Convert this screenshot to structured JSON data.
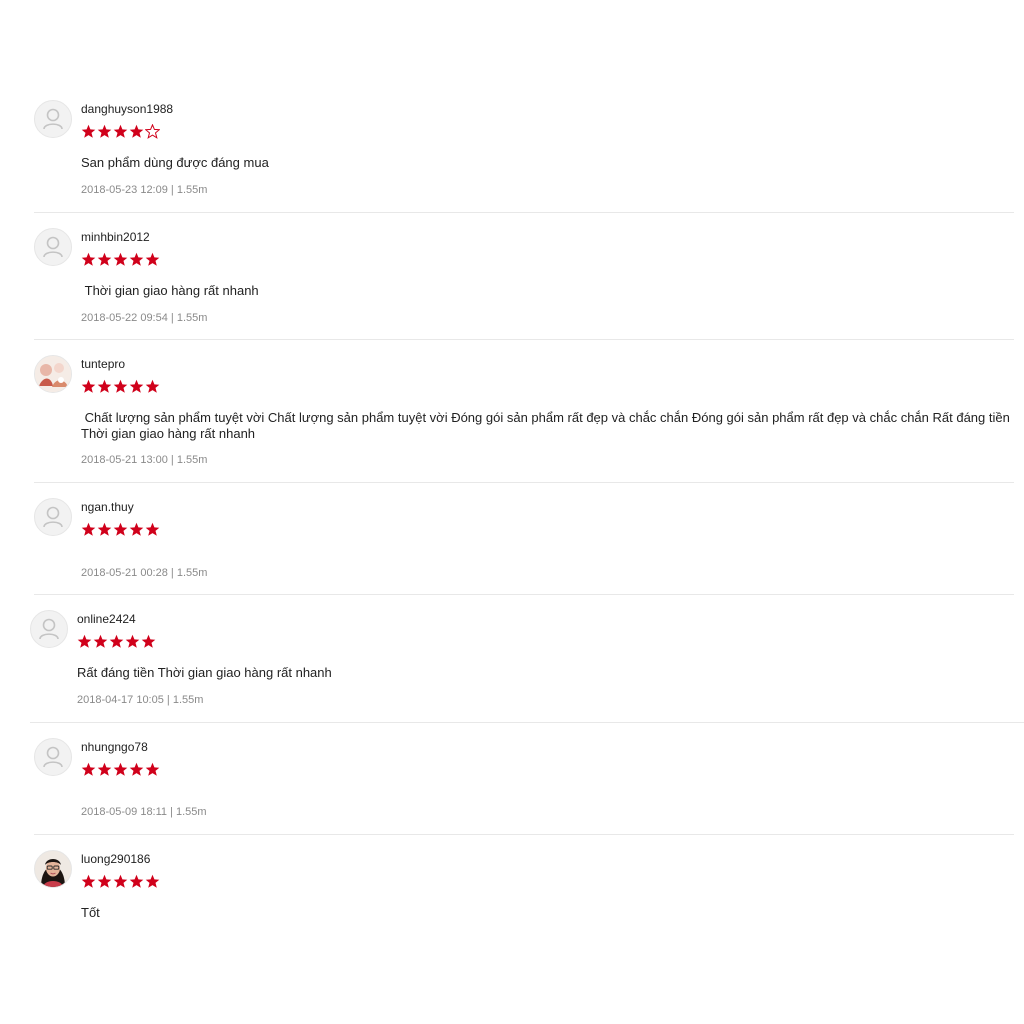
{
  "colors": {
    "star_filled": "#d0011b",
    "star_empty_stroke": "#d0011b",
    "divider": "#e8e8e8",
    "meta_text": "#8a8a8a"
  },
  "reviews": [
    {
      "username": "danghuyson1988",
      "rating": 4,
      "max_rating": 5,
      "comment": "San phẩm dùng được đáng mua",
      "meta": "2018-05-23 12:09 | 1.55m",
      "avatar": "default-user-icon"
    },
    {
      "username": "minhbin2012",
      "rating": 5,
      "max_rating": 5,
      "comment": " Thời gian giao hàng rất nhanh",
      "meta": "2018-05-22 09:54 | 1.55m",
      "avatar": "default-user-icon"
    },
    {
      "username": "tuntepro",
      "rating": 5,
      "max_rating": 5,
      "comment": " Chất lượng sản phẩm tuyệt vời Chất lượng sản phẩm tuyệt vời Đóng gói sản phẩm rất đẹp và chắc chắn Đóng gói sản phẩm rất đẹp và chắc chắn Rất đáng tiền Thời gian giao hàng rất nhanh",
      "meta": "2018-05-21 13:00 | 1.55m",
      "avatar": "photo-avatar"
    },
    {
      "username": "ngan.thuy",
      "rating": 5,
      "max_rating": 5,
      "comment": "",
      "meta": "2018-05-21 00:28 | 1.55m",
      "avatar": "default-user-icon"
    },
    {
      "username": "online2424",
      "rating": 5,
      "max_rating": 5,
      "comment": "Rất đáng tiền Thời gian giao hàng rất nhanh",
      "meta": "2018-04-17 10:05 | 1.55m",
      "avatar": "default-user-icon"
    },
    {
      "username": "nhungngo78",
      "rating": 5,
      "max_rating": 5,
      "comment": "",
      "meta": "2018-05-09 18:11 | 1.55m",
      "avatar": "default-user-icon"
    },
    {
      "username": "luong290186",
      "rating": 5,
      "max_rating": 5,
      "comment": "Tốt",
      "meta": "",
      "avatar": "photo-avatar"
    }
  ]
}
